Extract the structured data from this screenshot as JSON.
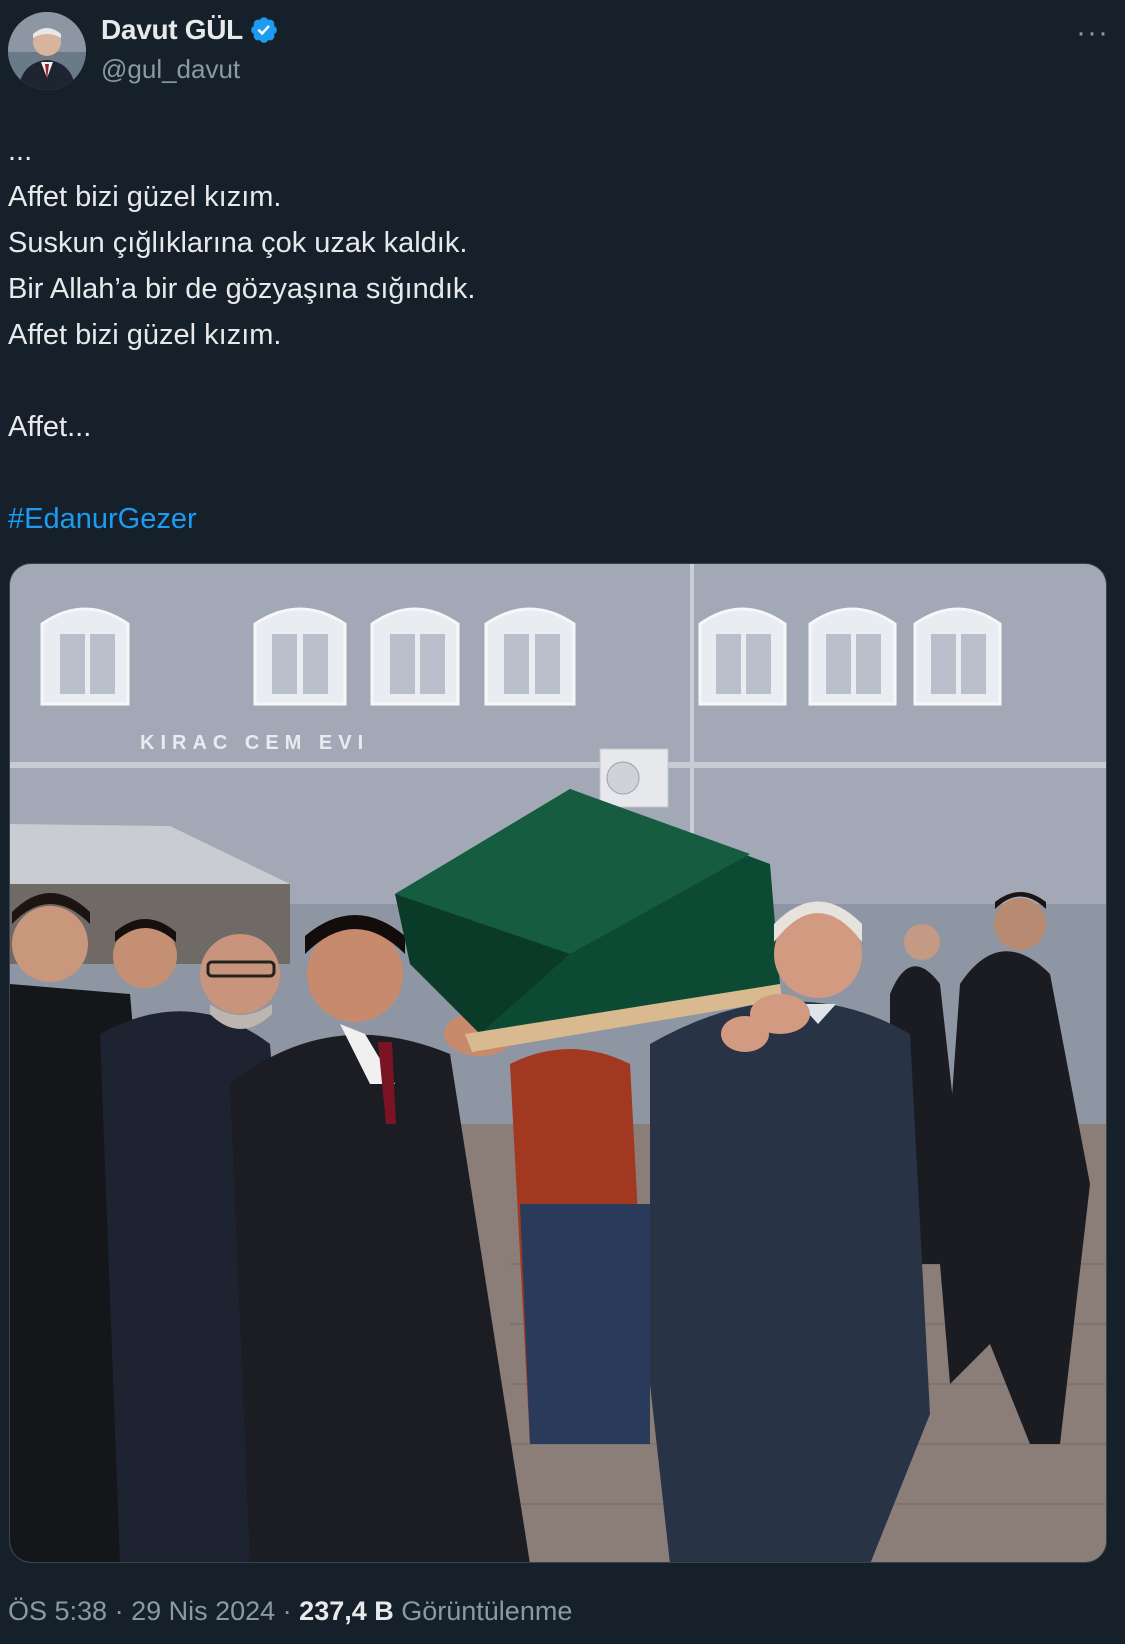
{
  "author": {
    "display_name": "Davut GÜL",
    "handle": "@gul_davut",
    "verified": true,
    "avatar_icon": "profile-photo"
  },
  "more_icon": "more-options-icon",
  "tweet": {
    "lines": [
      "...",
      "Affet bizi güzel kızım.",
      "Suskun çığlıklarına çok uzak kaldık.",
      "Bir Allah’a bir de gözyaşına sığındık.",
      "Affet bizi güzel kızım.",
      "",
      "Affet...",
      "",
      "#EdanurGezer"
    ],
    "hashtag": "#EdanurGezer"
  },
  "media": {
    "building_sign": "KIRAC CEM EVI"
  },
  "footer": {
    "time": "ÖS 5:38",
    "sep1": " · ",
    "date": "29 Nis 2024",
    "sep2": " · ",
    "views_count": "237,4 B",
    "views_label": " Görüntülenme"
  },
  "colors": {
    "background": "#15202b",
    "link": "#1d9bf0",
    "secondary_text": "#8b98a5",
    "coffin_cloth": "#0d4a33"
  }
}
